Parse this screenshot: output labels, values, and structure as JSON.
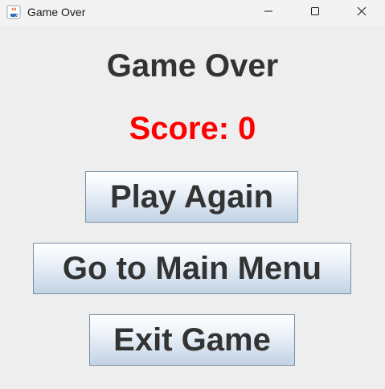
{
  "window": {
    "title": "Game Over",
    "app_icon": "java-coffee-icon",
    "controls": {
      "minimize_icon": "minimize-icon",
      "maximize_icon": "maximize-icon",
      "close_icon": "close-icon"
    }
  },
  "main": {
    "heading": "Game Over",
    "score_text": "Score: 0",
    "score_color": "#ff0000",
    "buttons": {
      "play_again": "Play Again",
      "main_menu": "Go to Main Menu",
      "exit_game": "Exit Game"
    }
  }
}
